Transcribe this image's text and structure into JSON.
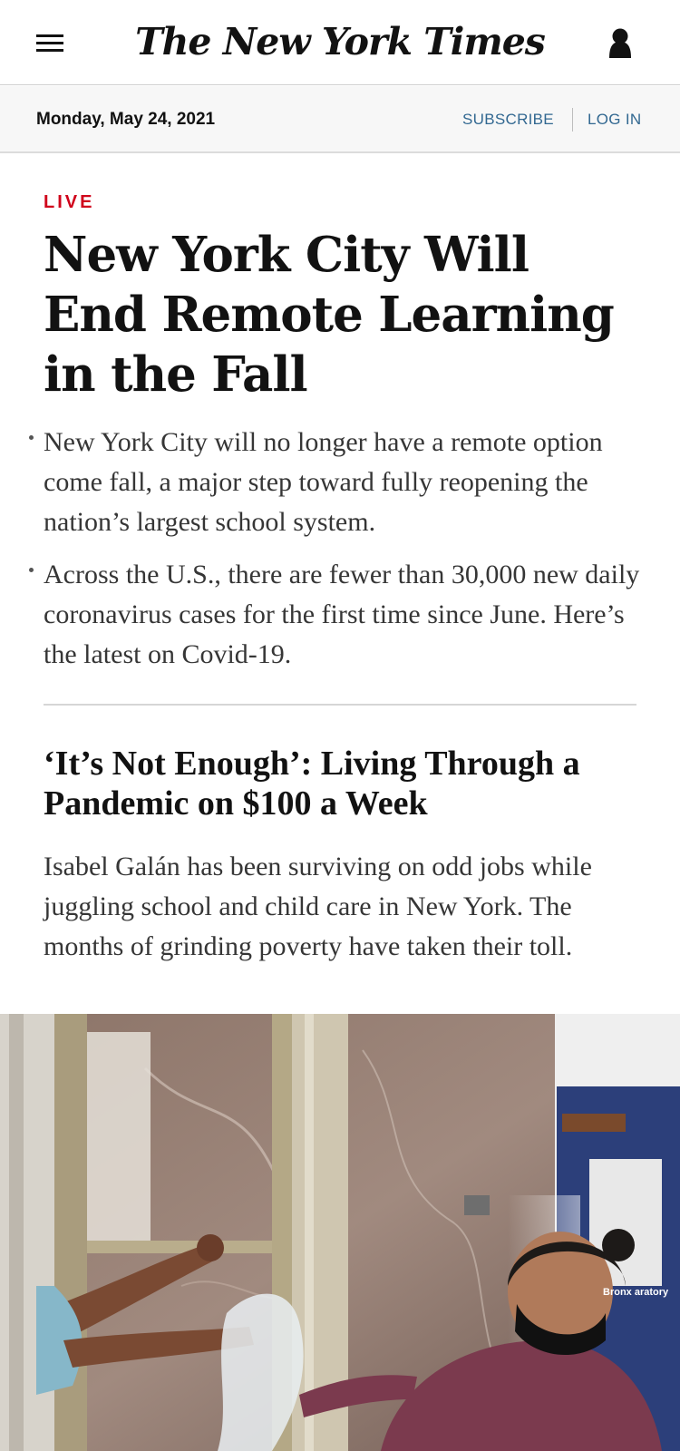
{
  "header": {
    "menu_icon": "hamburger-menu-icon",
    "logo_text": "The New York Times",
    "account_icon": "user-account-icon"
  },
  "datebar": {
    "date": "Monday, May 24, 2021",
    "subscribe_label": "SUBSCRIBE",
    "login_label": "LOG IN"
  },
  "lead_story": {
    "label": "LIVE",
    "headline": "New York City Will End Remote Learning in the Fall",
    "bullets": [
      "New York City will no longer have a remote option come fall, a major step toward fully reopening the nation’s largest school system.",
      "Across the U.S., there are fewer than 30,000 new daily coronavirus cases for the first time since June. Here’s the latest on Covid-19."
    ]
  },
  "second_story": {
    "headline": "‘It’s Not Enough’: Living Through a Pandemic on $100 a Week",
    "summary": "Isabel Galán has been surviving on odd jobs while juggling school and child care in New York. The months of grinding poverty have taken their toll.",
    "photo_sign_text": "Bronx aratory"
  },
  "colors": {
    "live_red": "#d0021b",
    "link_blue": "#326891",
    "datebar_bg": "#f7f7f7"
  }
}
